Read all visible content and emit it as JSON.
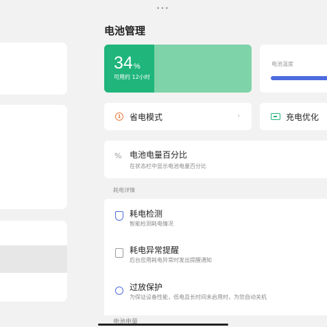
{
  "page": {
    "title": "电池管理",
    "top_dots": "•••"
  },
  "battery": {
    "percent": "34",
    "percent_unit": "%",
    "level": 0.34,
    "remaining": "可用约 12小时"
  },
  "temperature": {
    "label": "电池温度"
  },
  "quick_cards": {
    "power_saving": {
      "icon": "1",
      "label": "省电模式",
      "chevron": "›"
    },
    "charging_optimization": {
      "label": "充电优化"
    }
  },
  "battery_percentage": {
    "icon": "%",
    "title": "电池电量百分比",
    "subtitle": "在状态栏中显示电池电量百分比"
  },
  "consumption_section": {
    "label": "耗电详情",
    "items": [
      {
        "icon": "shield-icon",
        "title": "耗电检测",
        "subtitle": "智能检测耗电情况"
      },
      {
        "icon": "alert-box-icon",
        "title": "耗电异常提醒",
        "subtitle": "后台应用耗电异常时发出提醒通知"
      },
      {
        "icon": "power-icon",
        "title": "过放保护",
        "subtitle": "为保证设备性能，低电且长时间未启用时，为您自动关机"
      }
    ]
  },
  "bottom_section": {
    "label": "电池电量"
  },
  "colors": {
    "accent_green": "#1fb57b",
    "light_green": "#7ed3a8",
    "blue": "#4d6bdf",
    "orange": "#f07b3d"
  }
}
